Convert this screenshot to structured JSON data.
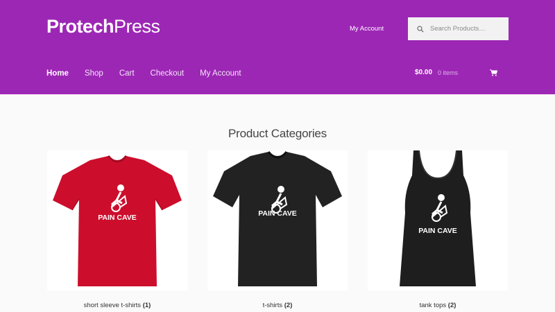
{
  "header": {
    "logo_bold": "Protech",
    "logo_regular": "Press",
    "top_account": "My Account",
    "search_placeholder": "Search Products…",
    "brand_color": "#9d27b5"
  },
  "nav": {
    "items": [
      "Home",
      "Shop",
      "Cart",
      "Checkout",
      "My Account"
    ],
    "active": "Home"
  },
  "cart": {
    "amount": "$0.00",
    "count": "0 items",
    "icon": "cart-icon"
  },
  "main": {
    "title": "Product Categories",
    "categories": [
      {
        "name": "short sleeve t-shirts",
        "count": "(1)",
        "print": "PAIN CAVE",
        "color": "#cc0e2c"
      },
      {
        "name": "t-shirts",
        "count": "(2)",
        "print": "PAIN CAVE",
        "color": "#222222"
      },
      {
        "name": "tank tops",
        "count": "(2)",
        "print": "PAIN CAVE",
        "color": "#1e1e1e"
      }
    ]
  }
}
